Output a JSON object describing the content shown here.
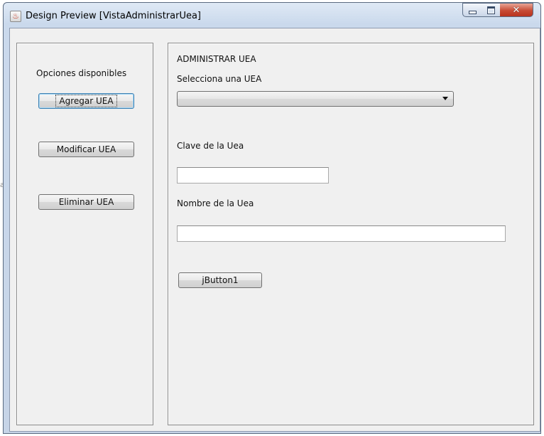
{
  "window": {
    "title": "Design Preview [VistaAdministrarUea]",
    "icon": "java-cup-icon"
  },
  "sidebar": {
    "heading": "Opciones disponibles",
    "buttons": [
      {
        "label": "Agregar UEA"
      },
      {
        "label": "Modificar UEA"
      },
      {
        "label": "Eliminar UEA"
      }
    ]
  },
  "main": {
    "title": "ADMINISTRAR UEA",
    "select_label": "Selecciona una UEA",
    "select_value": "",
    "clave_label": "Clave de la Uea",
    "clave_value": "",
    "nombre_label": "Nombre de la Uea",
    "nombre_value": "",
    "action_button": "jButton1"
  },
  "colors": {
    "panel_bg": "#f0f0f0",
    "close_button": "#c74b35",
    "focus_border": "#3c7fb1"
  }
}
